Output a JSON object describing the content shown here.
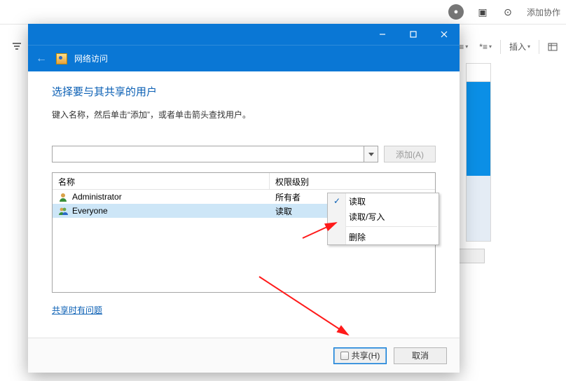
{
  "bg": {
    "add_collab": "添加协作",
    "insert_label": "插入",
    "line_spacing_icon": "≡",
    "list_bullets_icon": "≣"
  },
  "dialog": {
    "window_title": "网络访问",
    "heading": "选择要与其共享的用户",
    "subtext": "键入名称，然后单击“添加”，或者单击箭头查找用户。",
    "add_button": "添加(A)",
    "columns": {
      "name": "名称",
      "perm": "权限级别"
    },
    "rows": [
      {
        "name": "Administrator",
        "perm": "所有者",
        "selected": false,
        "has_caret": false
      },
      {
        "name": "Everyone",
        "perm": "读取",
        "selected": true,
        "has_caret": true
      }
    ],
    "help_link": "共享时有问题",
    "share_button": "共享(H)",
    "cancel_button": "取消"
  },
  "perm_menu": {
    "read": "读取",
    "readwrite": "读取/写入",
    "delete": "删除"
  }
}
